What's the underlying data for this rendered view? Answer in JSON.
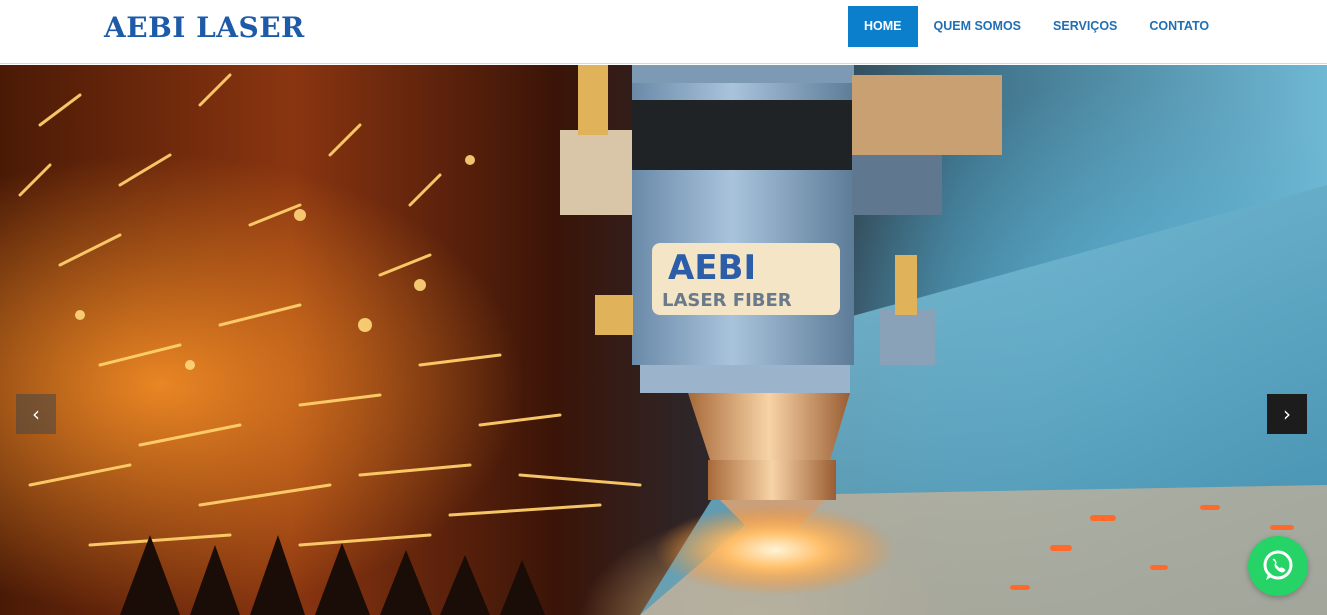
{
  "header": {
    "logo_text": "AEBI LASER",
    "nav": [
      {
        "label": "HOME",
        "active": true
      },
      {
        "label": "QUEM SOMOS",
        "active": false
      },
      {
        "label": "SERVIÇOS",
        "active": false
      },
      {
        "label": "CONTATO",
        "active": false
      }
    ]
  },
  "hero": {
    "image_label_line1": "AEBI",
    "image_label_line2": "LASER FIBER",
    "prev_icon": "‹",
    "next_icon": "›"
  },
  "icons": {
    "prev": "chevron-left-icon",
    "next": "chevron-right-icon",
    "chat": "whatsapp-icon"
  },
  "colors": {
    "brand": "#1d5aa8",
    "nav_active_bg": "#0c7fcc",
    "nav_text": "#1f6fb5",
    "whatsapp": "#25d366"
  }
}
